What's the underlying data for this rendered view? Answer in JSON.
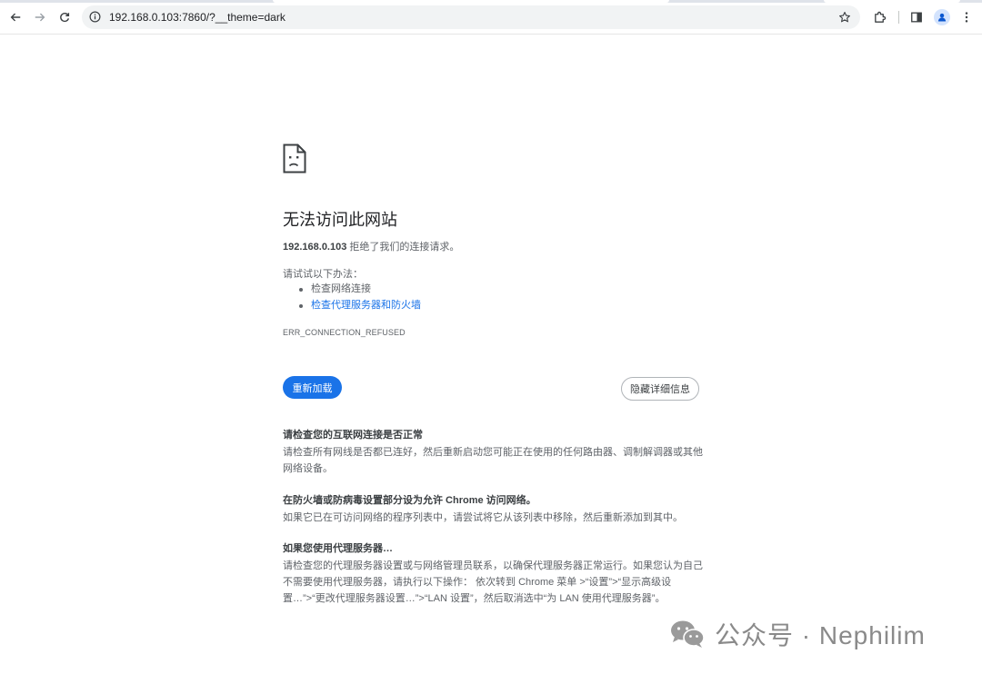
{
  "browser": {
    "url": "192.168.0.103:7860/?__theme=dark",
    "icons": {
      "back": "arrow-left-icon",
      "forward": "arrow-right-icon",
      "reload": "reload-icon",
      "site_info": "info-icon",
      "bookmark": "star-icon",
      "extensions": "puzzle-icon",
      "side_panel": "side-panel-icon",
      "profile": "profile-icon",
      "menu": "kebab-menu-icon"
    }
  },
  "error_page": {
    "heading": "无法访问此网站",
    "host": "192.168.0.103",
    "refused_suffix": " 拒绝了我们的连接请求。",
    "try_label": "请试试以下办法：",
    "suggestions": [
      {
        "label": "检查网络连接",
        "is_link": false
      },
      {
        "label": "检查代理服务器和防火墙",
        "is_link": true
      }
    ],
    "error_code": "ERR_CONNECTION_REFUSED",
    "reload_button": "重新加载",
    "details_button": "隐藏详细信息",
    "details": [
      {
        "title": "请检查您的互联网连接是否正常",
        "body": "请检查所有网线是否都已连好，然后重新启动您可能正在使用的任何路由器、调制解调器或其他网络设备。"
      },
      {
        "title": "在防火墙或防病毒设置部分设为允许 Chrome 访问网络。",
        "body": "如果它已在可访问网络的程序列表中，请尝试将它从该列表中移除，然后重新添加到其中。"
      },
      {
        "title": "如果您使用代理服务器…",
        "body": "请检查您的代理服务器设置或与网络管理员联系，以确保代理服务器正常运行。如果您认为自己不需要使用代理服务器，请执行以下操作： 依次转到 Chrome 菜单 >“设置”>“显示高级设置…”>“更改代理服务器设置…”>“LAN 设置”，然后取消选中“为 LAN 使用代理服务器”。"
      }
    ],
    "colors": {
      "primary_button": "#1a73e8",
      "link": "#1a73e8",
      "text": "#202124",
      "secondary_text": "#5f6368"
    }
  },
  "watermark": {
    "text": "公众号 · Nephilim",
    "icon": "wechat-logo-icon"
  }
}
